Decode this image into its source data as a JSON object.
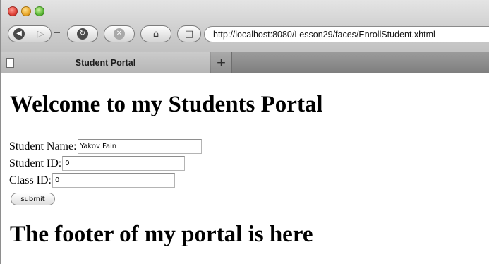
{
  "browser": {
    "url": "http://localhost:8080/Lesson29/faces/EnrollStudent.xhtml",
    "tab_title": "Student Portal",
    "new_tab_label": "+"
  },
  "page": {
    "heading": "Welcome to my Students Portal",
    "footer": "The footer of my portal is here"
  },
  "form": {
    "student_name_label": "Student Name:",
    "student_name_value": "Yakov Fain",
    "student_id_label": "Student ID:",
    "student_id_value": "0",
    "class_id_label": "Class ID:",
    "class_id_value": "0",
    "submit_label": "submit"
  },
  "icons": {
    "close": "close-window-icon",
    "minimize": "minimize-window-icon",
    "zoom": "zoom-window-icon",
    "back": "back-arrow-icon",
    "forward": "forward-arrow-icon",
    "reload": "reload-icon",
    "stop": "stop-icon",
    "home": "home-icon",
    "bookmark": "bookmark-page-icon",
    "page": "page-icon"
  },
  "colors": {
    "window_close": "#e0443a",
    "window_minimize": "#e9a72b",
    "window_zoom": "#5fba3a"
  }
}
